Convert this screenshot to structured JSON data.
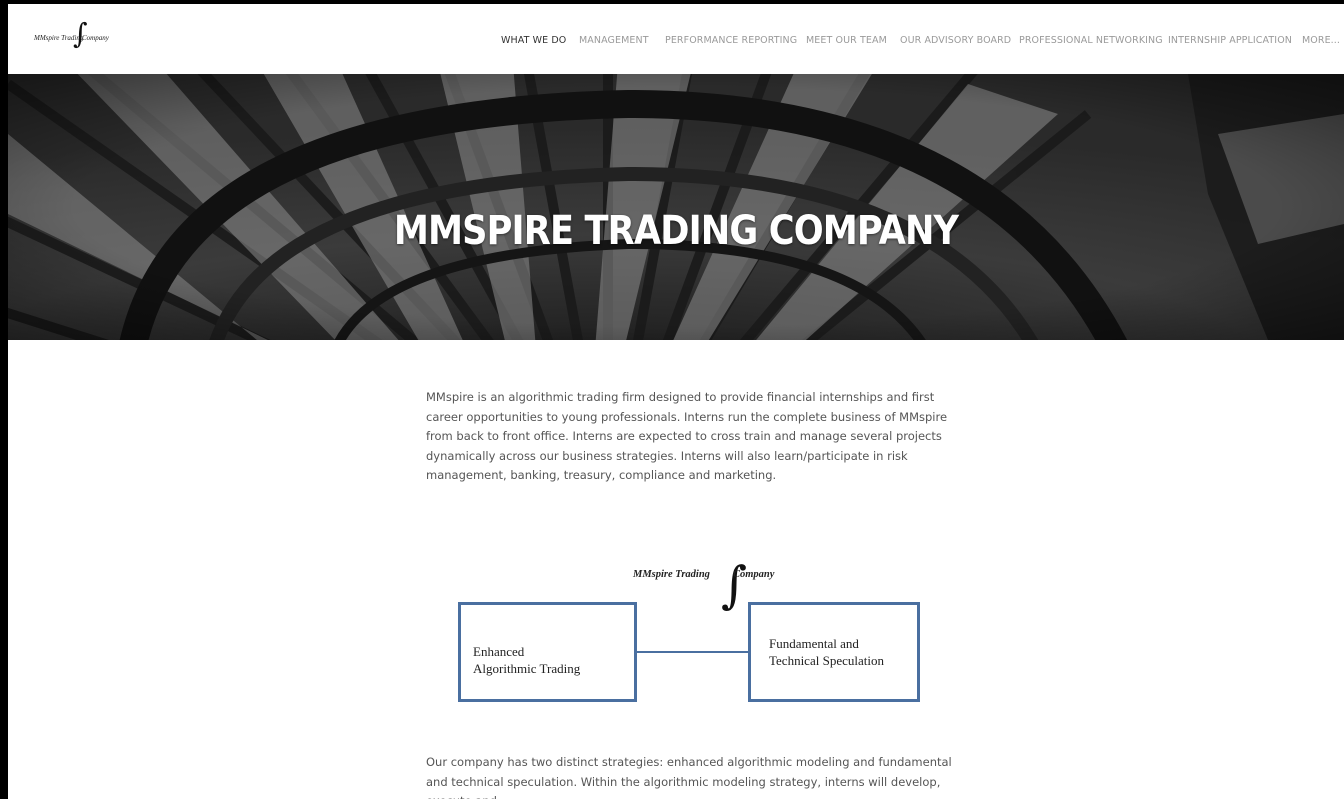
{
  "logo": {
    "left_text": "MMspire Trading",
    "right_text": "Company",
    "integral": "∫"
  },
  "nav": {
    "items": [
      {
        "label": "WHAT WE DO",
        "active": true
      },
      {
        "label": "MANAGEMENT"
      },
      {
        "label": "PERFORMANCE REPORTING"
      },
      {
        "label": "MEET OUR TEAM"
      },
      {
        "label": "OUR ADVISORY BOARD"
      },
      {
        "label": "PROFESSIONAL NETWORKING"
      },
      {
        "label": "INTERNSHIP APPLICATION"
      },
      {
        "label": "MORE..."
      }
    ]
  },
  "hero": {
    "title": "MMSPIRE TRADING COMPANY"
  },
  "intro": {
    "text": "MMspire is an algorithmic trading firm designed to provide financial internships and first career opportunities to young professionals.  Interns run the complete business of MMspire from back to front office. Interns are expected to cross train and manage several projects dynamically across our business strategies.  Interns will also learn/participate in risk management, banking, treasury, compliance and marketing."
  },
  "diagram": {
    "logo_left": "MMspire Trading",
    "logo_right": "Company",
    "integral": "∫",
    "box_left": "Enhanced\nAlgorithmic Trading",
    "box_right": "Fundamental and\nTechnical Speculation"
  },
  "strategies": {
    "text": "Our company has two distinct strategies: enhanced algorithmic modeling and fundamental and technical speculation. Within the algorithmic modeling strategy, interns will develop, execute and"
  },
  "colors": {
    "accent": "#4a6fa0",
    "nav_active": "#333333",
    "nav_inactive": "#9a9a9a"
  }
}
